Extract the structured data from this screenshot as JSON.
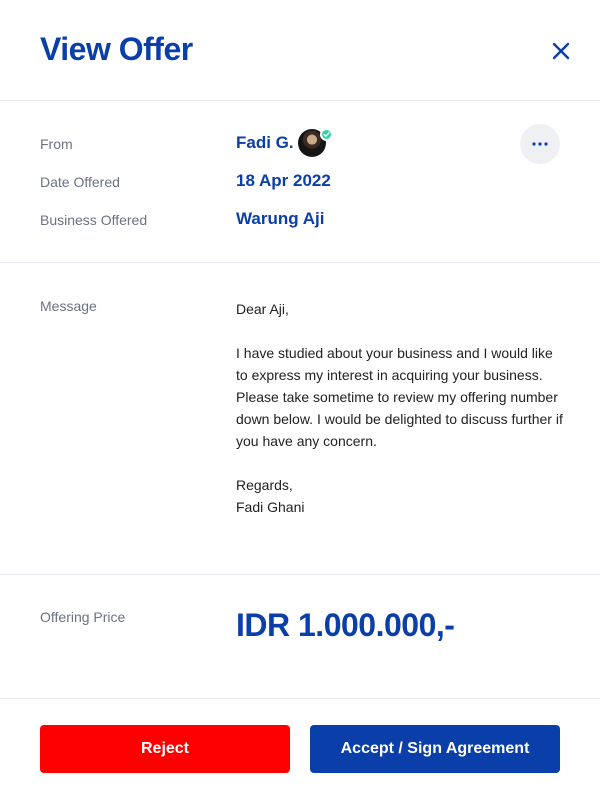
{
  "header": {
    "title": "View Offer",
    "close_icon": "close-icon"
  },
  "details": {
    "from_label": "From",
    "from_value": "Fadi G.",
    "date_label": "Date Offered",
    "date_value": "18 Apr 2022",
    "business_label": "Business Offered",
    "business_value": "Warung Aji",
    "more_icon": "more-horizontal-icon",
    "verified_color": "#2fd3a6"
  },
  "message": {
    "label": "Message",
    "greeting": "Dear Aji,",
    "body": "I have studied about your business and I would like to express my interest in acquiring your business. Please take sometime to review my offering number down below. I would be delighted to discuss further if you have any concern.",
    "closing": "Regards,",
    "signature": "Fadi Ghani"
  },
  "price": {
    "label": "Offering Price",
    "value": "IDR 1.000.000,-"
  },
  "actions": {
    "reject_label": "Reject",
    "accept_label": "Accept / Sign Agreement"
  },
  "colors": {
    "brand": "#0a3ea8",
    "reject": "#ff0000",
    "divider": "#e6e9ef"
  }
}
